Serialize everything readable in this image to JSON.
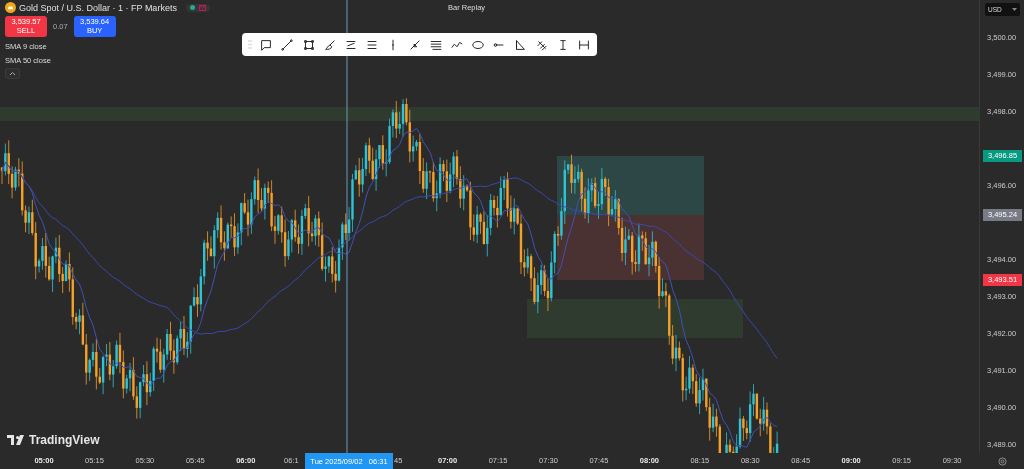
{
  "symbol": {
    "title": "Gold Spot / U.S. Dollar · 1 · FP Markets",
    "market_open": true
  },
  "trade": {
    "sell_price": "3,539.57",
    "sell_label": "SELL",
    "spread": "0.07",
    "buy_price": "3,539.64",
    "buy_label": "BUY"
  },
  "indicators": [
    {
      "label": "SMA 9 close"
    },
    {
      "label": "SMA 50 close"
    }
  ],
  "replay": {
    "title": "Bar Replay"
  },
  "currency": "USD",
  "price_axis": {
    "ticks": [
      "3,500.00",
      "3,499.00",
      "3,498.00",
      "3,496.00",
      "3,494.00",
      "3,493.00",
      "3,492.00",
      "3,491.00",
      "3,490.00",
      "3,489.00"
    ],
    "markers": [
      {
        "label": "3,496.85",
        "color": "#089981"
      },
      {
        "label": "3,495.24",
        "color": "#787b86"
      },
      {
        "label": "3,493.51",
        "color": "#f23645"
      }
    ]
  },
  "time_axis": {
    "labels": [
      {
        "text": "05:00",
        "major": true,
        "kind": "full"
      },
      {
        "text": "05:15",
        "major": false,
        "kind": "full"
      },
      {
        "text": "05:30",
        "major": false,
        "kind": "full"
      },
      {
        "text": "05:45",
        "major": false,
        "kind": "full"
      },
      {
        "text": "06:00",
        "major": true,
        "kind": "full"
      },
      {
        "text": "06:1",
        "major": false,
        "kind": "cut_before"
      },
      {
        "text": "45",
        "major": false,
        "kind": "cut_after"
      },
      {
        "text": "07:00",
        "major": true,
        "kind": "full"
      },
      {
        "text": "07:15",
        "major": false,
        "kind": "full"
      },
      {
        "text": "07:30",
        "major": false,
        "kind": "full"
      },
      {
        "text": "07:45",
        "major": false,
        "kind": "full"
      },
      {
        "text": "08:00",
        "major": true,
        "kind": "full"
      },
      {
        "text": "08:15",
        "major": false,
        "kind": "full"
      },
      {
        "text": "08:30",
        "major": false,
        "kind": "full"
      },
      {
        "text": "08:45",
        "major": false,
        "kind": "full"
      },
      {
        "text": "09:00",
        "major": true,
        "kind": "full"
      },
      {
        "text": "09:15",
        "major": false,
        "kind": "full"
      },
      {
        "text": "09:30",
        "major": false,
        "kind": "full"
      }
    ],
    "crosshair": {
      "date": "Tue 2025/09/02",
      "time": "06:31"
    }
  },
  "brand": "TradingView"
}
